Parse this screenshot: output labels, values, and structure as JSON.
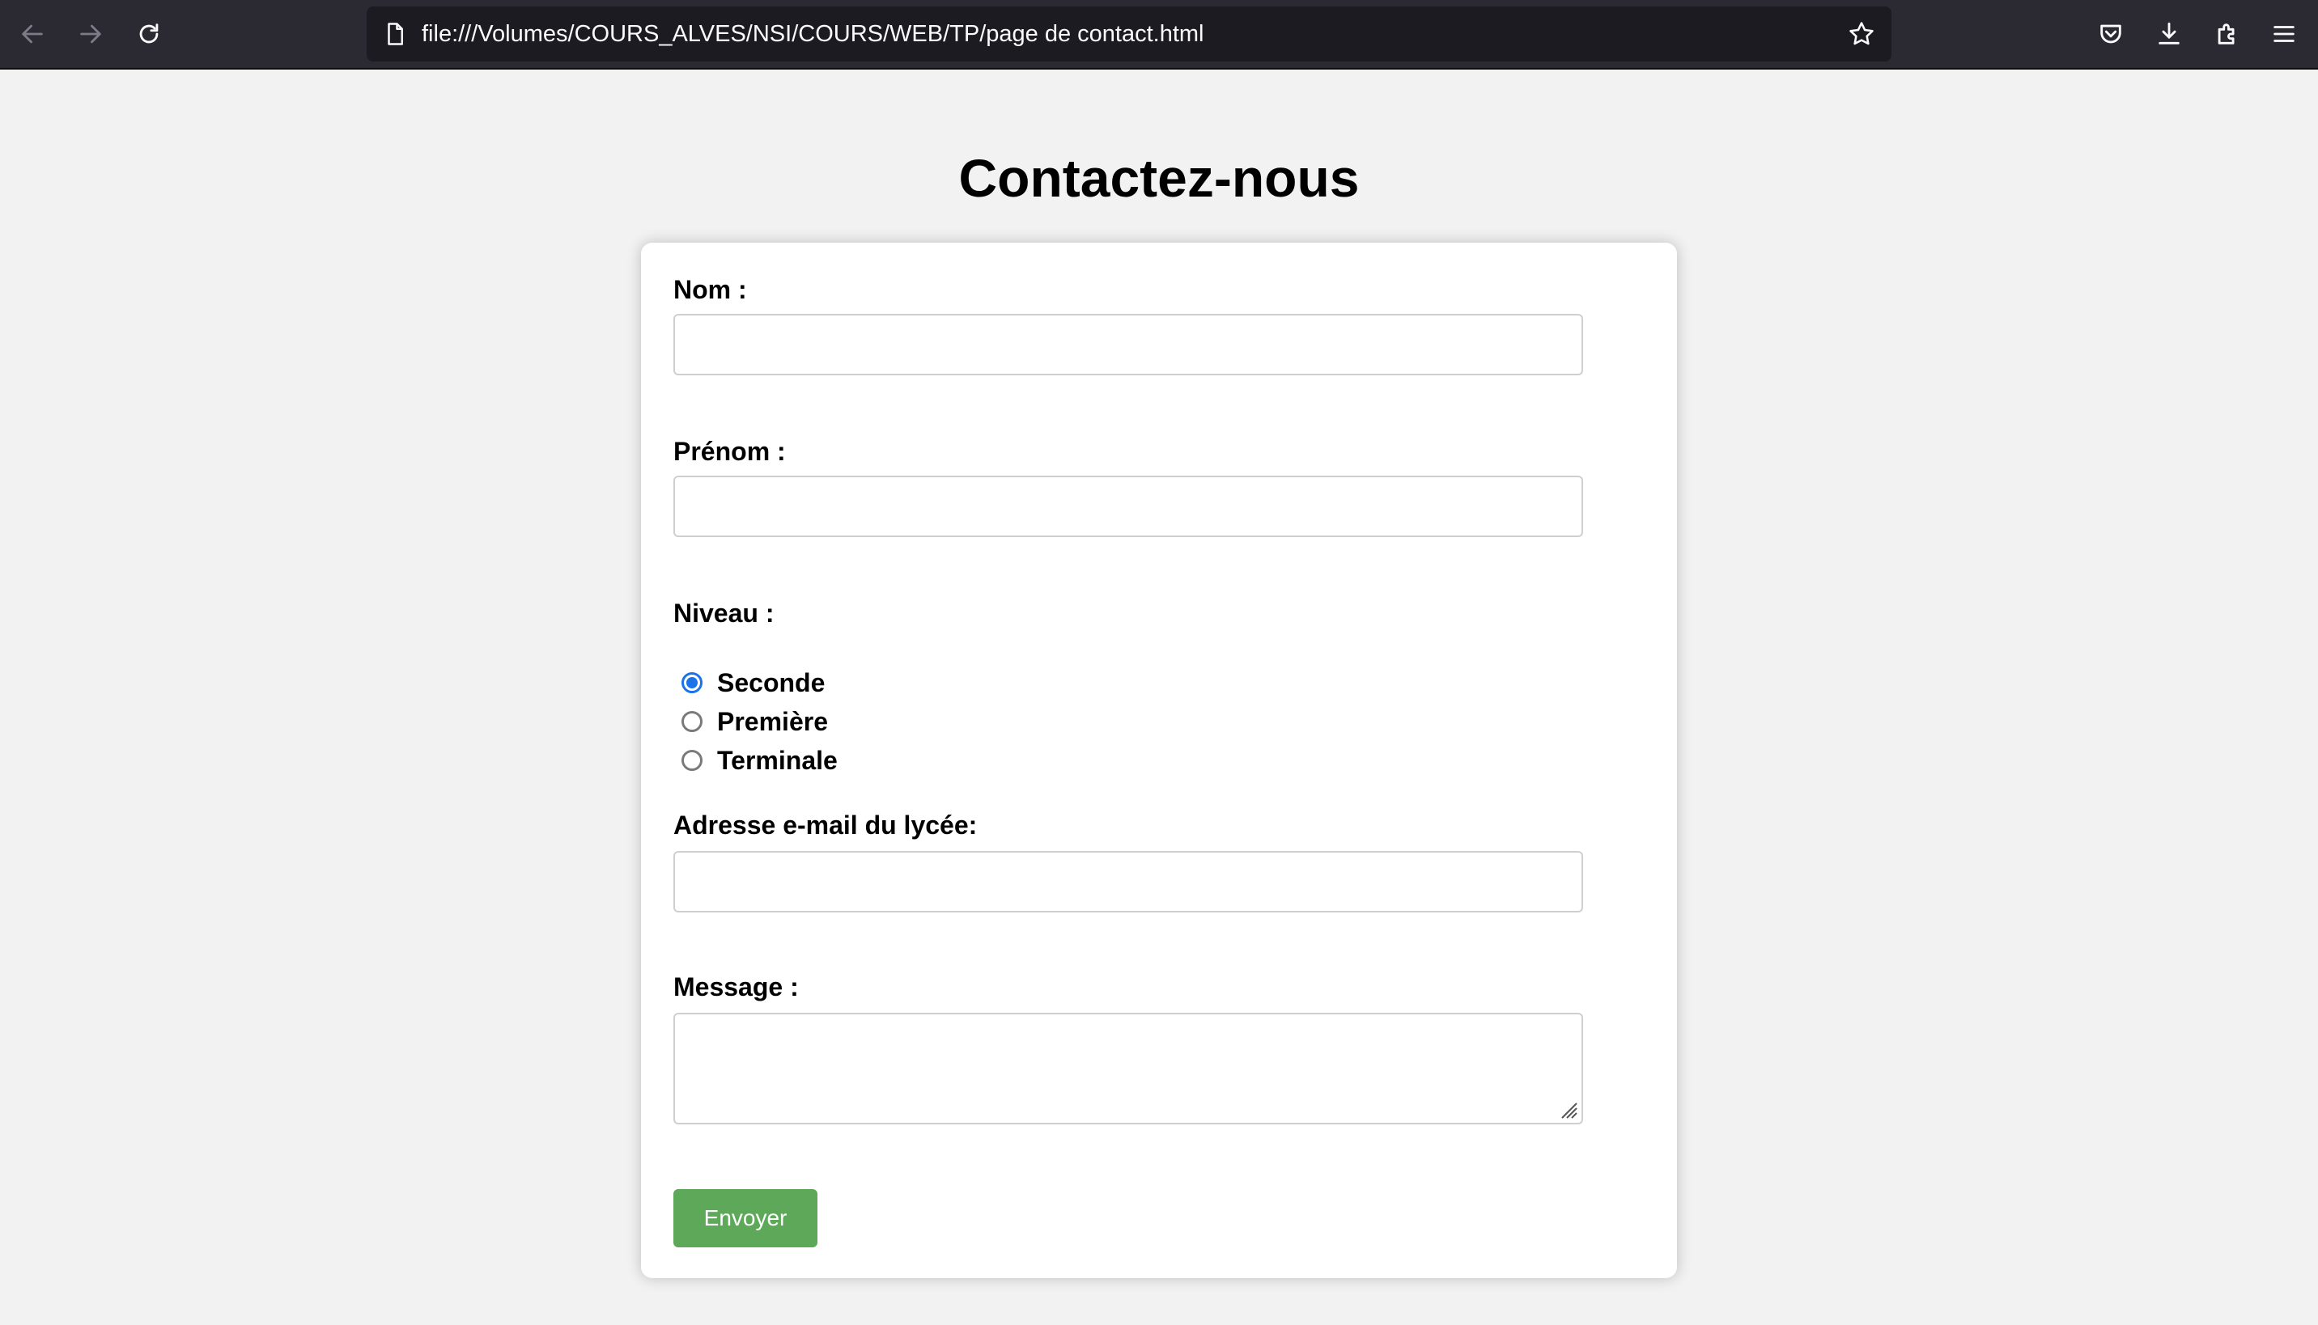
{
  "browser": {
    "url": "file:///Volumes/COURS_ALVES/NSI/COURS/WEB/TP/page de contact.html",
    "icons": {
      "back": "arrow-left-icon",
      "forward": "arrow-right-icon",
      "reload": "reload-icon",
      "page": "page-icon",
      "bookmark": "star-icon",
      "pocket": "pocket-icon",
      "downloads": "download-icon",
      "extensions": "puzzle-icon",
      "menu": "hamburger-menu-icon"
    },
    "colors": {
      "toolbar_bg": "#2b2a33",
      "urlbar_bg": "#1c1b22"
    }
  },
  "page": {
    "title": "Contactez-nous",
    "background": "#f2f2f2"
  },
  "form": {
    "nom_label": "Nom :",
    "nom_value": "",
    "prenom_label": "Prénom :",
    "prenom_value": "",
    "niveau_label": "Niveau :",
    "niveau_options": [
      {
        "label": "Seconde",
        "checked": true
      },
      {
        "label": "Première",
        "checked": false
      },
      {
        "label": "Terminale",
        "checked": false
      }
    ],
    "email_label": "Adresse e-mail du lycée:",
    "email_value": "",
    "message_label": "Message :",
    "message_value": "",
    "submit_label": "Envoyer",
    "submit_color": "#5ea85a",
    "radio_accent": "#1a73e8"
  }
}
